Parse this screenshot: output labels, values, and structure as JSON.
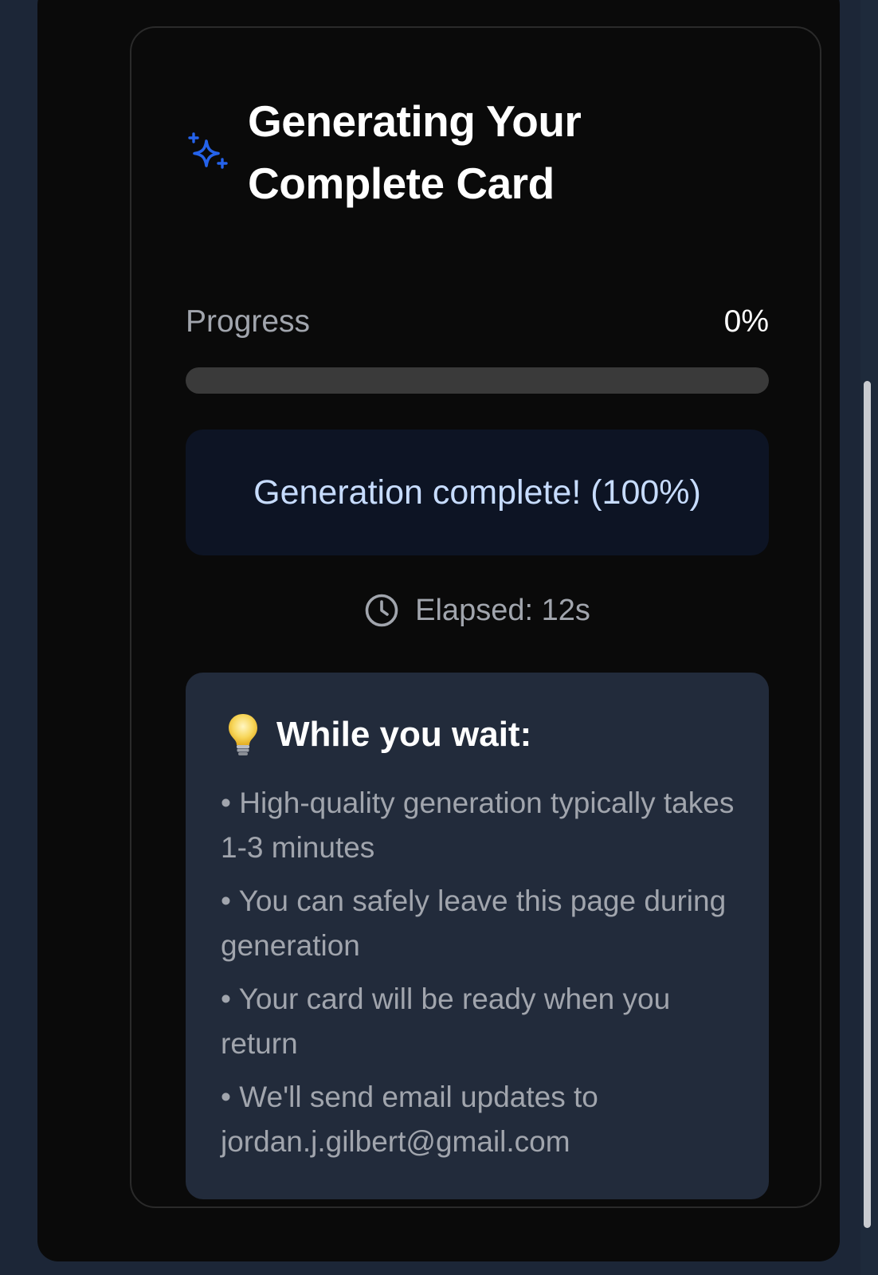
{
  "card": {
    "title": "Generating Your Complete Card",
    "icon": "sparkles-icon",
    "accent_color": "#2563eb"
  },
  "progress": {
    "label": "Progress",
    "value_text": "0%",
    "fraction": 0
  },
  "status": {
    "message": "Generation complete! (100%)"
  },
  "elapsed": {
    "icon": "clock-icon",
    "text": "Elapsed: 12s"
  },
  "tips": {
    "icon": "lightbulb-icon",
    "title": "While you wait:",
    "items": [
      "• High-quality generation typically takes 1-3 minutes",
      "• You can safely leave this page during generation",
      "• Your card will be ready when you return",
      "• We'll send email updates to jordan.j.gilbert@gmail.com"
    ]
  }
}
